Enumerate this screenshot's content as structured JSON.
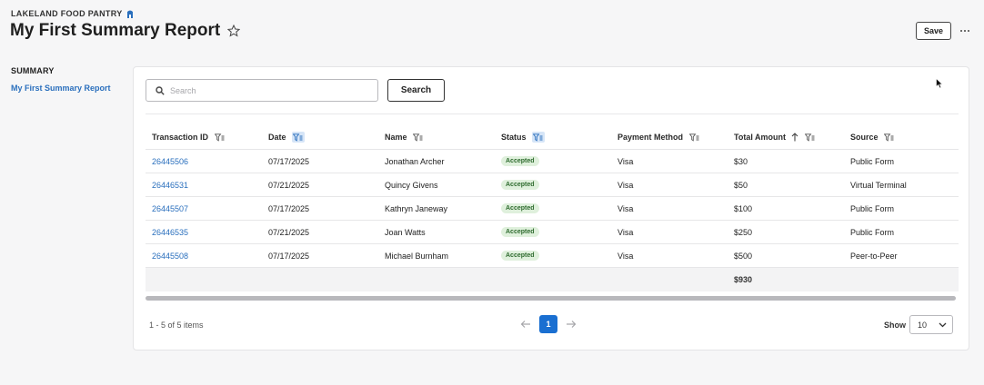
{
  "header": {
    "org_name": "LAKELAND FOOD PANTRY",
    "report_title": "My First Summary Report",
    "save_label": "Save",
    "more_label": "⋯"
  },
  "sidebar": {
    "heading": "SUMMARY",
    "items": [
      {
        "label": "My First Summary Report",
        "active": true
      }
    ]
  },
  "search": {
    "placeholder": "Search",
    "value": "",
    "button_label": "Search"
  },
  "table": {
    "columns": [
      {
        "label": "Transaction ID",
        "filter_active": false,
        "sorted": false
      },
      {
        "label": "Date",
        "filter_active": true,
        "sorted": false
      },
      {
        "label": "Name",
        "filter_active": false,
        "sorted": false
      },
      {
        "label": "Status",
        "filter_active": true,
        "sorted": false
      },
      {
        "label": "Payment Method",
        "filter_active": false,
        "sorted": false
      },
      {
        "label": "Total Amount",
        "filter_active": false,
        "sorted": true,
        "sort_direction": "ascending"
      },
      {
        "label": "Source",
        "filter_active": false,
        "sorted": false
      }
    ],
    "rows": [
      [
        "26445506",
        "07/17/2025",
        "Jonathan Archer",
        "Accepted",
        "Visa",
        "$30",
        "Public Form"
      ],
      [
        "26446531",
        "07/21/2025",
        "Quincy Givens",
        "Accepted",
        "Visa",
        "$50",
        "Virtual Terminal"
      ],
      [
        "26445507",
        "07/17/2025",
        "Kathryn Janeway",
        "Accepted",
        "Visa",
        "$100",
        "Public Form"
      ],
      [
        "26446535",
        "07/21/2025",
        "Joan Watts",
        "Accepted",
        "Visa",
        "$250",
        "Public Form"
      ],
      [
        "26445508",
        "07/17/2025",
        "Michael Burnham",
        "Accepted",
        "Visa",
        "$500",
        "Peer-to-Peer"
      ]
    ],
    "total_amount": "$930"
  },
  "pagination": {
    "items_text": "1 - 5 of 5 items",
    "current_page": "1",
    "show_label": "Show",
    "page_size": "10"
  },
  "colors": {
    "link": "#2a6fbd",
    "primary": "#1a6fd1",
    "status_bg": "#dff0dc",
    "status_text": "#2e6b2e"
  }
}
